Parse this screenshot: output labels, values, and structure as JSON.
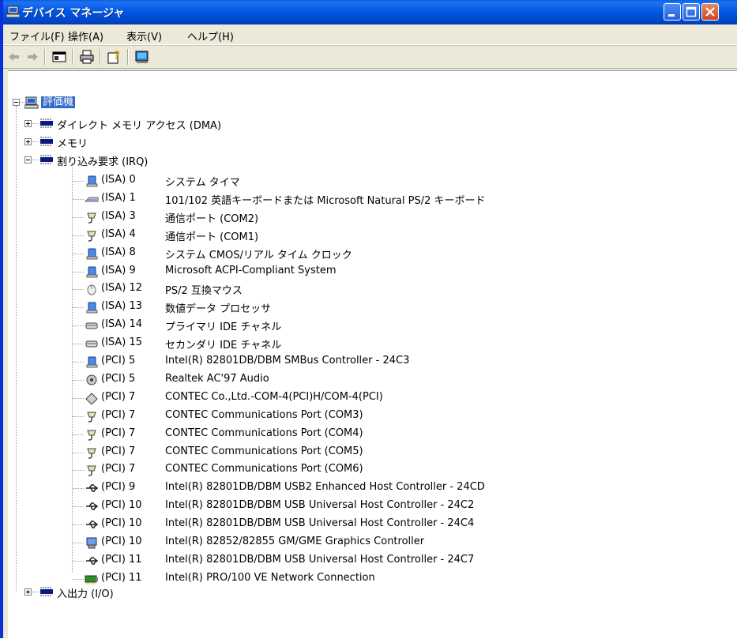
{
  "window": {
    "title": "デバイス マネージャ"
  },
  "menu": [
    "ファイル(F)",
    "操作(A)",
    "表示(V)",
    "ヘルプ(H)"
  ],
  "tree": {
    "root": "評価機",
    "categories": [
      {
        "label": "ダイレクト メモリ アクセス (DMA)",
        "expanded": false
      },
      {
        "label": "メモリ",
        "expanded": false
      },
      {
        "label": "割り込み要求 (IRQ)",
        "expanded": true
      }
    ],
    "irq_items": [
      {
        "irq": "(ISA) 0",
        "name": "システム タイマ",
        "icon": "system-device-icon"
      },
      {
        "irq": "(ISA) 1",
        "name": "101/102 英語キーボードまたは Microsoft Natural PS/2 キーボード",
        "icon": "keyboard-icon"
      },
      {
        "irq": "(ISA) 3",
        "name": "通信ポート (COM2)",
        "icon": "port-icon"
      },
      {
        "irq": "(ISA) 4",
        "name": "通信ポート (COM1)",
        "icon": "port-icon"
      },
      {
        "irq": "(ISA) 8",
        "name": "システム CMOS/リアル タイム クロック",
        "icon": "system-device-icon"
      },
      {
        "irq": "(ISA) 9",
        "name": "Microsoft ACPI-Compliant System",
        "icon": "system-device-icon"
      },
      {
        "irq": "(ISA) 12",
        "name": "PS/2 互換マウス",
        "icon": "mouse-icon"
      },
      {
        "irq": "(ISA) 13",
        "name": "数値データ プロセッサ",
        "icon": "system-device-icon"
      },
      {
        "irq": "(ISA) 14",
        "name": "プライマリ IDE チャネル",
        "icon": "ide-icon"
      },
      {
        "irq": "(ISA) 15",
        "name": "セカンダリ IDE チャネル",
        "icon": "ide-icon"
      },
      {
        "irq": "(PCI) 5",
        "name": "Intel(R) 82801DB/DBM SMBus Controller - 24C3",
        "icon": "system-device-icon"
      },
      {
        "irq": "(PCI) 5",
        "name": "Realtek AC'97 Audio",
        "icon": "audio-icon"
      },
      {
        "irq": "(PCI) 7",
        "name": "CONTEC Co.,Ltd.-COM-4(PCI)H/COM-4(PCI)",
        "icon": "multifunction-icon"
      },
      {
        "irq": "(PCI) 7",
        "name": "CONTEC Communications Port (COM3)",
        "icon": "port-icon"
      },
      {
        "irq": "(PCI) 7",
        "name": "CONTEC Communications Port (COM4)",
        "icon": "port-icon"
      },
      {
        "irq": "(PCI) 7",
        "name": "CONTEC Communications Port (COM5)",
        "icon": "port-icon"
      },
      {
        "irq": "(PCI) 7",
        "name": "CONTEC Communications Port (COM6)",
        "icon": "port-icon"
      },
      {
        "irq": "(PCI) 9",
        "name": "Intel(R) 82801DB/DBM USB2 Enhanced Host Controller - 24CD",
        "icon": "usb-icon"
      },
      {
        "irq": "(PCI) 10",
        "name": "Intel(R) 82801DB/DBM USB Universal Host Controller - 24C2",
        "icon": "usb-icon"
      },
      {
        "irq": "(PCI) 10",
        "name": "Intel(R) 82801DB/DBM USB Universal Host Controller - 24C4",
        "icon": "usb-icon"
      },
      {
        "irq": "(PCI) 10",
        "name": "Intel(R) 82852/82855 GM/GME Graphics Controller",
        "icon": "display-icon"
      },
      {
        "irq": "(PCI) 11",
        "name": "Intel(R) 82801DB/DBM USB Universal Host Controller - 24C7",
        "icon": "usb-icon"
      },
      {
        "irq": "(PCI) 11",
        "name": "Intel(R) PRO/100 VE Network Connection",
        "icon": "network-icon"
      }
    ],
    "last_category": {
      "label": "入出力 (I/O)",
      "expanded": false
    }
  }
}
